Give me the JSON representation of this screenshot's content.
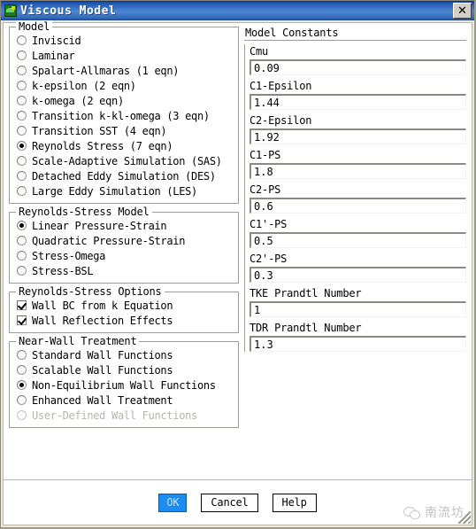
{
  "window": {
    "title": "Viscous Model",
    "icon": "fluent-app-icon",
    "close_label": "✕"
  },
  "model_group": {
    "legend": "Model",
    "options": [
      {
        "label": "Inviscid",
        "selected": false,
        "disabled": false
      },
      {
        "label": "Laminar",
        "selected": false,
        "disabled": false
      },
      {
        "label": "Spalart-Allmaras (1 eqn)",
        "selected": false,
        "disabled": false
      },
      {
        "label": "k-epsilon (2 eqn)",
        "selected": false,
        "disabled": false
      },
      {
        "label": "k-omega (2 eqn)",
        "selected": false,
        "disabled": false
      },
      {
        "label": "Transition k-kl-omega (3 eqn)",
        "selected": false,
        "disabled": false
      },
      {
        "label": "Transition SST (4 eqn)",
        "selected": false,
        "disabled": false
      },
      {
        "label": "Reynolds Stress (7 eqn)",
        "selected": true,
        "disabled": false
      },
      {
        "label": "Scale-Adaptive Simulation (SAS)",
        "selected": false,
        "disabled": false
      },
      {
        "label": "Detached Eddy Simulation (DES)",
        "selected": false,
        "disabled": false
      },
      {
        "label": "Large Eddy Simulation (LES)",
        "selected": false,
        "disabled": false
      }
    ]
  },
  "reynolds_stress_model_group": {
    "legend": "Reynolds-Stress Model",
    "options": [
      {
        "label": "Linear Pressure-Strain",
        "selected": true,
        "disabled": false
      },
      {
        "label": "Quadratic Pressure-Strain",
        "selected": false,
        "disabled": false
      },
      {
        "label": "Stress-Omega",
        "selected": false,
        "disabled": false
      },
      {
        "label": "Stress-BSL",
        "selected": false,
        "disabled": false
      }
    ]
  },
  "reynolds_stress_options_group": {
    "legend": "Reynolds-Stress Options",
    "options": [
      {
        "label": "Wall BC from k Equation",
        "checked": true,
        "disabled": false
      },
      {
        "label": "Wall Reflection Effects",
        "checked": true,
        "disabled": false
      }
    ]
  },
  "near_wall_treatment_group": {
    "legend": "Near-Wall Treatment",
    "options": [
      {
        "label": "Standard Wall Functions",
        "selected": false,
        "disabled": false
      },
      {
        "label": "Scalable Wall Functions",
        "selected": false,
        "disabled": false
      },
      {
        "label": "Non-Equilibrium Wall Functions",
        "selected": true,
        "disabled": false
      },
      {
        "label": "Enhanced Wall Treatment",
        "selected": false,
        "disabled": false
      },
      {
        "label": "User-Defined Wall Functions",
        "selected": false,
        "disabled": true
      }
    ]
  },
  "model_constants": {
    "title": "Model Constants",
    "fields": [
      {
        "label": "Cmu",
        "value": "0.09"
      },
      {
        "label": "C1-Epsilon",
        "value": "1.44"
      },
      {
        "label": "C2-Epsilon",
        "value": "1.92"
      },
      {
        "label": "C1-PS",
        "value": "1.8"
      },
      {
        "label": "C2-PS",
        "value": "0.6"
      },
      {
        "label": "C1'-PS",
        "value": "0.5"
      },
      {
        "label": "C2'-PS",
        "value": "0.3"
      },
      {
        "label": "TKE Prandtl Number",
        "value": "1"
      },
      {
        "label": "TDR Prandtl Number",
        "value": "1.3"
      }
    ]
  },
  "footer": {
    "ok_label": "OK",
    "cancel_label": "Cancel",
    "help_label": "Help",
    "watermark_text": "南流坊"
  },
  "colors": {
    "titlebar_blue": "#3d78c8",
    "primary_button": "#1b8cf0",
    "panel_bg": "#ffffff",
    "frame": "#ece9d8"
  }
}
